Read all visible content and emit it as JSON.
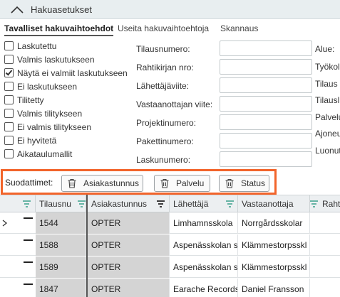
{
  "panel": {
    "title": "Hakuasetukset",
    "toggle_icon": "chevron-up-icon"
  },
  "tabs": [
    {
      "label": "Tavalliset hakuvaihtoehdot",
      "active": true
    },
    {
      "label": "Useita hakuvaihtoehtoja",
      "active": false
    },
    {
      "label": "Skannaus",
      "active": false
    }
  ],
  "checkboxes": [
    {
      "label": "Laskutettu",
      "checked": false
    },
    {
      "label": "Valmis laskutukseen",
      "checked": false
    },
    {
      "label": "Näytä ei valmiit laskutukseen",
      "checked": true
    },
    {
      "label": "Ei laskutukseen",
      "checked": false
    },
    {
      "label": "Tilitetty",
      "checked": false
    },
    {
      "label": "Valmis tilitykseen",
      "checked": false
    },
    {
      "label": "Ei valmis tilitykseen",
      "checked": false
    },
    {
      "label": "Ei hyvitetä",
      "checked": false
    },
    {
      "label": "Aikataulumallit",
      "checked": false
    }
  ],
  "fields": [
    {
      "label": "Tilausnumero:",
      "value": ""
    },
    {
      "label": "Rahtikirjan nro:",
      "value": ""
    },
    {
      "label": "Lähettäjäviite:",
      "value": ""
    },
    {
      "label": "Vastaanottajan viite:",
      "value": ""
    },
    {
      "label": "Projektinumero:",
      "value": ""
    },
    {
      "label": "Pakettinumero:",
      "value": ""
    },
    {
      "label": "Laskunumero:",
      "value": ""
    }
  ],
  "right_fields": [
    "Alue:",
    "Työkol",
    "Tilaus",
    "Tilausl",
    "Palvelu",
    "Ajoneu",
    "Luonut"
  ],
  "filters": {
    "label": "Suodattimet:",
    "chips": [
      "Asiakastunnus",
      "Palvelu",
      "Status"
    ],
    "chip_icon": "trash-icon",
    "highlight_color": "#f2642a"
  },
  "grid": {
    "columns": [
      "",
      "Tilausnu",
      "Asiakastunnus",
      "Lähettäjä",
      "Vastaanottaja",
      "Rahtikir"
    ],
    "rows": [
      {
        "order": "1544",
        "customer": "OPTER",
        "sender": "Limhamnsskola",
        "receiver": "Norrgårdsskolar",
        "current": true
      },
      {
        "order": "1588",
        "customer": "OPTER",
        "sender": "Aspenässkolan s",
        "receiver": "Klämmestorpsskl",
        "current": false
      },
      {
        "order": "1589",
        "customer": "OPTER",
        "sender": "Aspenässkolan s",
        "receiver": "Klämmestorpsskl",
        "current": false
      },
      {
        "order": "1847",
        "customer": "OPTER",
        "sender": "Earache Records",
        "receiver": "Daniel Fransson",
        "current": false
      }
    ],
    "shaded_color": "#d4d4d4",
    "filter_icon_color": "#3aa08a"
  }
}
